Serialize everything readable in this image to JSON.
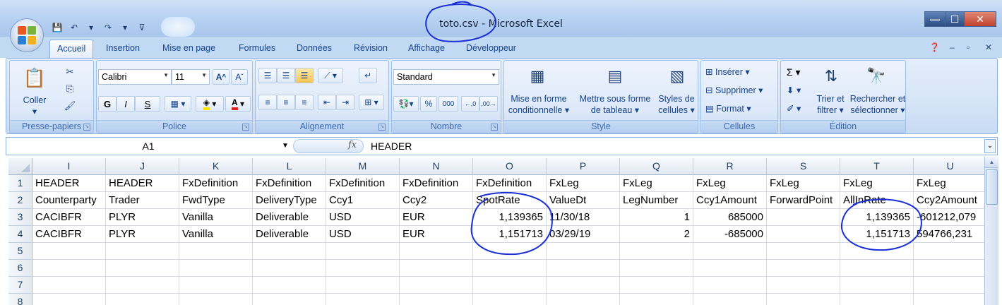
{
  "window": {
    "title": "toto.csv - Microsoft Excel",
    "buttons": {
      "minimize": "—",
      "maximize": "☐",
      "close": "✕"
    }
  },
  "tabs": [
    {
      "label": "Accueil",
      "active": true
    },
    {
      "label": "Insertion"
    },
    {
      "label": "Mise en page"
    },
    {
      "label": "Formules"
    },
    {
      "label": "Données"
    },
    {
      "label": "Révision"
    },
    {
      "label": "Affichage"
    },
    {
      "label": "Développeur"
    }
  ],
  "ribbon": {
    "clipboard": {
      "label": "Presse-papiers",
      "paste": "Coller"
    },
    "font": {
      "label": "Police",
      "name": "Calibri",
      "size": "11",
      "bold": "G",
      "italic": "I",
      "underline": "S"
    },
    "alignment": {
      "label": "Alignement"
    },
    "number": {
      "label": "Nombre",
      "format": "Standard",
      "percent": "%",
      "thousands": "000"
    },
    "style": {
      "label": "Style",
      "conditional": [
        "Mise en forme",
        "conditionnelle"
      ],
      "table": [
        "Mettre sous forme",
        "de tableau"
      ],
      "cell_styles": [
        "Styles de",
        "cellules"
      ]
    },
    "cells": {
      "label": "Cellules",
      "insert": "Insérer",
      "delete": "Supprimer",
      "format": "Format"
    },
    "editing": {
      "label": "Édition",
      "sum": "Σ",
      "sort": [
        "Trier et",
        "filtrer"
      ],
      "find": [
        "Rechercher et",
        "sélectionner"
      ]
    }
  },
  "formula_bar": {
    "name_box": "A1",
    "fx": "fx",
    "value": "HEADER"
  },
  "sheet": {
    "columns": [
      "I",
      "J",
      "K",
      "L",
      "M",
      "N",
      "O",
      "P",
      "Q",
      "R",
      "S",
      "T",
      "U"
    ],
    "row_numbers": [
      "1",
      "2",
      "3",
      "4",
      "5",
      "6",
      "7",
      "8"
    ],
    "rows": [
      [
        "HEADER",
        "HEADER",
        "FxDefinition",
        "FxDefinition",
        "FxDefinition",
        "FxDefinition",
        "FxDefinition",
        "FxLeg",
        "FxLeg",
        "FxLeg",
        "FxLeg",
        "FxLeg",
        "FxLeg"
      ],
      [
        "Counterparty",
        "Trader",
        "FwdType",
        "DeliveryType",
        "Ccy1",
        "Ccy2",
        "SpotRate",
        "ValueDt",
        "LegNumber",
        "Ccy1Amount",
        "ForwardPoint",
        "AllInRate",
        "Ccy2Amount"
      ],
      [
        "CACIBFR",
        "PLYR",
        "Vanilla",
        "Deliverable",
        "USD",
        "EUR",
        "1,139365",
        "11/30/18",
        "1",
        "685000",
        "",
        "1,139365",
        "-601212,079"
      ],
      [
        "CACIBFR",
        "PLYR",
        "Vanilla",
        "Deliverable",
        "USD",
        "EUR",
        "1,151713",
        "03/29/19",
        "2",
        "-685000",
        "",
        "1,151713",
        "594766,231"
      ],
      [
        "",
        "",
        "",
        "",
        "",
        "",
        "",
        "",
        "",
        "",
        "",
        "",
        ""
      ],
      [
        "",
        "",
        "",
        "",
        "",
        "",
        "",
        "",
        "",
        "",
        "",
        "",
        ""
      ],
      [
        "",
        "",
        "",
        "",
        "",
        "",
        "",
        "",
        "",
        "",
        "",
        "",
        ""
      ],
      [
        "",
        "",
        "",
        "",
        "",
        "",
        "",
        "",
        "",
        "",
        "",
        "",
        ""
      ]
    ],
    "numeric_right_aligned": [
      [
        2,
        6
      ],
      [
        2,
        8
      ],
      [
        2,
        9
      ],
      [
        2,
        11
      ],
      [
        3,
        6
      ],
      [
        3,
        8
      ],
      [
        3,
        9
      ],
      [
        3,
        11
      ]
    ]
  },
  "colors": {
    "annotation_ink": "#1a2fd6",
    "ribbon_text": "#15428b"
  }
}
